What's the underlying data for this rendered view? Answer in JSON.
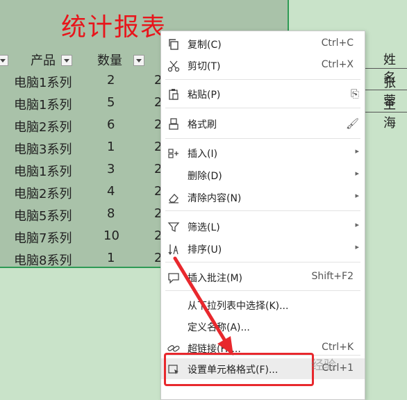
{
  "sheet": {
    "title": "统计报表",
    "headers": {
      "product": "产品",
      "quantity": "数量"
    },
    "rows": [
      {
        "product": "电脑1系列",
        "quantity": "2",
        "next": "2"
      },
      {
        "product": "电脑1系列",
        "quantity": "5",
        "next": "2"
      },
      {
        "product": "电脑2系列",
        "quantity": "6",
        "next": "2"
      },
      {
        "product": "电脑3系列",
        "quantity": "1",
        "next": "2"
      },
      {
        "product": "电脑1系列",
        "quantity": "3",
        "next": "2"
      },
      {
        "product": "电脑2系列",
        "quantity": "4",
        "next": "2"
      },
      {
        "product": "电脑5系列",
        "quantity": "8",
        "next": "2"
      },
      {
        "product": "电脑7系列",
        "quantity": "10",
        "next": "2"
      },
      {
        "product": "电脑8系列",
        "quantity": "1",
        "next": "2"
      }
    ],
    "right_table": [
      "姓名",
      "张蓉",
      "王海"
    ]
  },
  "menu": {
    "items": [
      {
        "label": "复制(C)",
        "shortcut": "Ctrl+C",
        "icon": "copy-icon"
      },
      {
        "label": "剪切(T)",
        "shortcut": "Ctrl+X",
        "icon": "scissors-icon"
      },
      {
        "label": "粘贴(P)",
        "icon": "paste-icon"
      },
      {
        "label": "格式刷",
        "icon": "format-painter-icon"
      },
      {
        "label": "插入(I)",
        "icon": "insert-icon"
      },
      {
        "label": "删除(D)"
      },
      {
        "label": "清除内容(N)",
        "icon": "eraser-icon"
      },
      {
        "label": "筛选(L)",
        "icon": "filter-icon"
      },
      {
        "label": "排序(U)",
        "icon": "sort-icon"
      },
      {
        "label": "插入批注(M)",
        "shortcut": "Shift+F2",
        "icon": "comment-icon"
      },
      {
        "label": "从下拉列表中选择(K)..."
      },
      {
        "label": "定义名称(A)..."
      },
      {
        "label": "超链接(H)...",
        "shortcut": "Ctrl+K",
        "icon": "link-icon"
      },
      {
        "label": "设置单元格格式(F)...",
        "shortcut": "Ctrl+1",
        "icon": "format-cells-icon"
      }
    ]
  },
  "colors": {
    "accent_red": "#e8282d",
    "title_red": "#e8151b",
    "selection_bg": "#a9c2a9"
  },
  "watermark": "经验"
}
